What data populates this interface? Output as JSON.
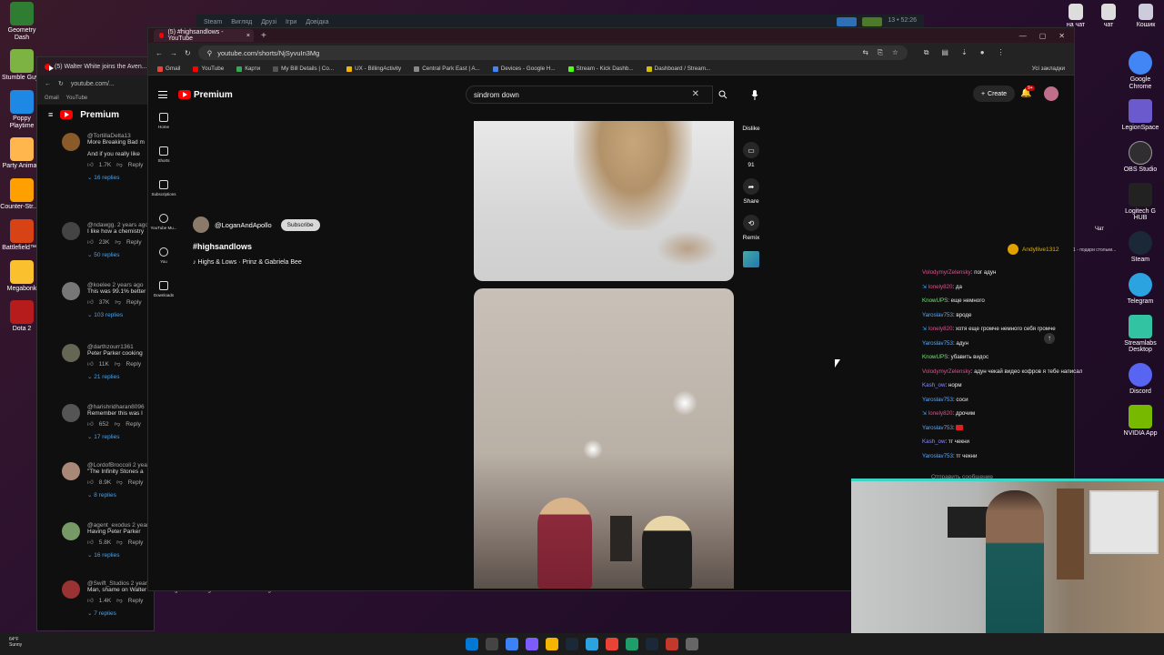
{
  "desktop": {
    "left_icons": [
      {
        "label": "Geometry Dash",
        "color": "#2e7d32"
      },
      {
        "label": "Stumble Guys",
        "color": "#7cb342"
      },
      {
        "label": "Poppy Playtime",
        "color": "#1e88e5"
      },
      {
        "label": "Party Animals",
        "color": "#ffb74d"
      },
      {
        "label": "Counter-Str... 2",
        "color": "#ffa000"
      },
      {
        "label": "Battlefield™ 6",
        "color": "#d84315"
      },
      {
        "label": "Megabonk",
        "color": "#fbc02d"
      },
      {
        "label": "Dota 2",
        "color": "#b71c1c"
      }
    ],
    "right_icons": [
      {
        "label": "Google Chrome",
        "color": "#4285f4"
      },
      {
        "label": "LegionSpace",
        "color": "#6a5acd"
      },
      {
        "label": "OBS Studio",
        "color": "#302e31"
      },
      {
        "label": "Logitech G HUB",
        "color": "#222222"
      },
      {
        "label": "Steam",
        "color": "#1b2838"
      },
      {
        "label": "Telegram",
        "color": "#2aa3e0"
      },
      {
        "label": "Streamlabs Desktop",
        "color": "#31c3a2"
      },
      {
        "label": "Discord",
        "color": "#5865f2"
      },
      {
        "label": "NVIDIA App",
        "color": "#76b900"
      }
    ],
    "top_right_labels": [
      "на чат",
      "чат",
      "Кошик"
    ],
    "chat_label": "Чат"
  },
  "steam_bar": {
    "items": [
      "Steam",
      "Вигляд",
      "Друзі",
      "Ігри",
      "Довідка"
    ],
    "clock": "13 • 52:26"
  },
  "back_window": {
    "tab_title": "(5) Walter White joins the Aven...",
    "url": "youtube.com/...",
    "bookmarks": [
      "Gmail",
      "YouTube"
    ],
    "brand": "Premium",
    "comments": [
      {
        "user": "@TortillaDelta13",
        "text": "More Breaking Bad m",
        "extra": "And if you really like",
        "likes": "1.7K",
        "replies": "16 replies",
        "avatar_color": "#8b5a2b"
      },
      {
        "user": "@ndawgg. 2 years ago",
        "text": "I like how a chemistry",
        "likes": "23K",
        "replies": "50 replies",
        "avatar_color": "#444"
      },
      {
        "user": "@koelee 2 years ago",
        "text": "This was 99.1% better",
        "likes": "37K",
        "replies": "103 replies",
        "avatar_color": "#777"
      },
      {
        "user": "@darthzourr1361",
        "text": "Peter Parker cooking",
        "likes": "11K",
        "replies": "21 replies",
        "avatar_color": "#665"
      },
      {
        "user": "@harishridharan8096",
        "text": "Remember this was l",
        "likes": "652",
        "replies": "17 replies",
        "avatar_color": "#555"
      },
      {
        "user": "@LordofBroccoli 2 years",
        "text": "\"The Infinity Stones a",
        "likes": "8.9K",
        "replies": "8 replies",
        "avatar_color": "#a87"
      },
      {
        "user": "@agent_exodus 2 year",
        "text": "Having Peter Parker",
        "likes": "5.8K",
        "replies": "16 replies",
        "avatar_color": "#796"
      },
      {
        "user": "@Swift_Studios 2 years",
        "text": "Man, shame on Walter for his drug war causing Mike's and Jesse's flight to be canceled.",
        "likes": "1.4K",
        "replies": "7 replies",
        "avatar_color": "#933"
      }
    ],
    "reply_label": "Reply"
  },
  "front_window": {
    "tab_title": "(5) #highsandlows - YouTube",
    "url": "youtube.com/shorts/NjSyvuIn3Mg",
    "bookmarks": [
      {
        "label": "Gmail",
        "color": "#ea4335"
      },
      {
        "label": "YouTube",
        "color": "#ff0000"
      },
      {
        "label": "Карти",
        "color": "#34a853"
      },
      {
        "label": "My Bill Details | Co...",
        "color": "#555"
      },
      {
        "label": "UX - BillingActivity",
        "color": "#f4b400"
      },
      {
        "label": "Central Park East | A...",
        "color": "#888"
      },
      {
        "label": "Devices - Google H...",
        "color": "#4285f4"
      },
      {
        "label": "Stream - Kick Dashb...",
        "color": "#53fc18"
      },
      {
        "label": "Dashboard / Stream...",
        "color": "#d4c000"
      }
    ],
    "bookmarks_right": "Усі закладки"
  },
  "youtube": {
    "brand": "Premium",
    "search_value": "sindrom down",
    "create_label": "Create",
    "notif_count": "9+",
    "nav": [
      {
        "label": "Home"
      },
      {
        "label": "Shorts"
      },
      {
        "label": "Subscriptions"
      },
      {
        "label": "YouTube Mu..."
      },
      {
        "label": "You"
      },
      {
        "label": "Downloads"
      }
    ],
    "short": {
      "channel": "@LoganAndApollo",
      "subscribe": "Subscribe",
      "title": "#highsandlows",
      "music": "♪ Highs & Lows · Prinz & Gabriela Bee"
    },
    "actions": {
      "dislike": "Dislike",
      "comments": "91",
      "share": "Share",
      "remix": "Remix"
    }
  },
  "chat": {
    "top_user": "Andyllive1312",
    "top_count": "1",
    "top_note": "1 - подари стольки...",
    "lines": [
      {
        "user": "VolodymyrZelensky",
        "msg": ": пог адун",
        "style": "c"
      },
      {
        "user": "lonely820",
        "msg": ": да",
        "style": "c",
        "badge": true
      },
      {
        "user": "KnowUPS",
        "msg": ": еще немного",
        "style": "b"
      },
      {
        "user": "Yaroslav753",
        "msg": ": вроде",
        "style": "a"
      },
      {
        "user": "lonely820",
        "msg": ": хотя еще громче немного себя громче",
        "style": "c",
        "badge": true
      },
      {
        "user": "Yaroslav753",
        "msg": ": адун",
        "style": "a"
      },
      {
        "user": "KnowUPS",
        "msg": ": убавить видос",
        "style": "b"
      },
      {
        "user": "VolodymyrZelensky",
        "msg": ": адун чекай видео кофров я тебе написал",
        "style": "c"
      },
      {
        "user": "Kash_ow",
        "msg": ": норм",
        "style": "d"
      },
      {
        "user": "Yaroslav753",
        "msg": ": соси",
        "style": "a"
      },
      {
        "user": "lonely820",
        "msg": ": дрочим",
        "style": "c",
        "badge": true
      },
      {
        "user": "Yaroslav753",
        "msg": ": ",
        "style": "a",
        "redbox": true
      },
      {
        "user": "Kash_ow",
        "msg": ": тг чекни",
        "style": "d"
      },
      {
        "user": "Yaroslav753",
        "msg": ": тг чекни",
        "style": "a"
      }
    ],
    "send_placeholder": "Отправить сообщение"
  },
  "taskbar": {
    "weather_temp": "64°F",
    "weather_desc": "Sunny",
    "icons": [
      "#0078d4",
      "#444",
      "#3b82f6",
      "#7c5cff",
      "#f4b400",
      "#1b2838",
      "#2aa3e0",
      "#ea4335",
      "#1e9e6b",
      "#1b2838",
      "#c0392b",
      "#666"
    ]
  }
}
